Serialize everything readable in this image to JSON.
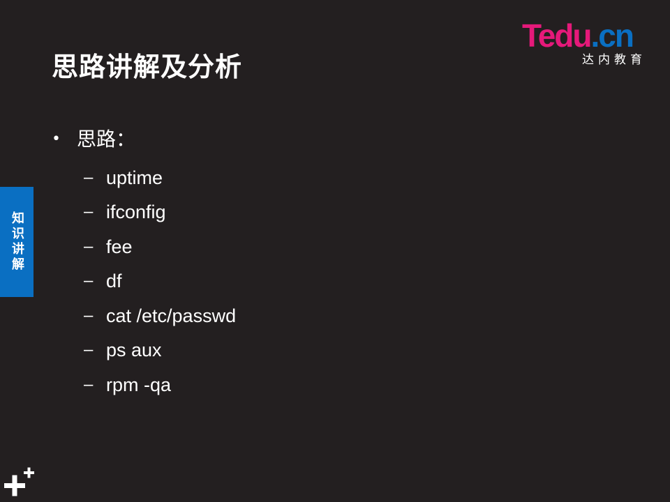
{
  "slide": {
    "title": "思路讲解及分析",
    "logo": {
      "brand_pink": "T",
      "brand_rest": "edu",
      "brand_dot": ".",
      "brand_cn": "cn",
      "subtitle": "达内教育"
    },
    "bullet": {
      "marker": "•",
      "label": "思路："
    },
    "sub_items": [
      "uptime",
      "ifconfig",
      "fee",
      "df",
      "cat /etc/passwd",
      "ps aux",
      "rpm -qa"
    ],
    "sub_marker": "–",
    "side_tab": "知识讲解",
    "icons": {
      "corner": "plus-icon"
    },
    "colors": {
      "background": "#231f20",
      "accent_blue": "#0a6fc2",
      "accent_pink": "#e5197a",
      "text": "#ffffff"
    }
  }
}
